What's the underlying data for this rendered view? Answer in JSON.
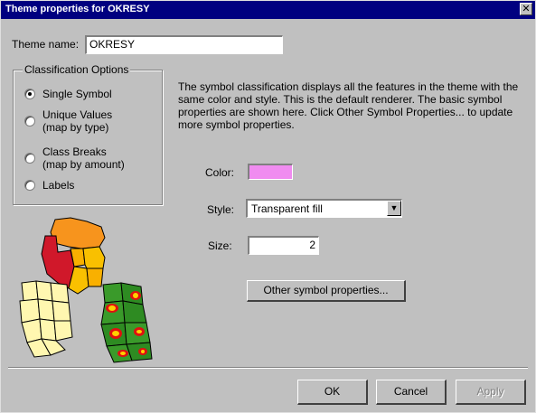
{
  "window": {
    "title": "Theme properties for OKRESY",
    "close_glyph": "✕"
  },
  "theme_name": {
    "label": "Theme name:",
    "value": "OKRESY"
  },
  "classification": {
    "legend": "Classification Options",
    "options": [
      {
        "line1": "Single Symbol",
        "line2": "",
        "checked": true
      },
      {
        "line1": "Unique Values",
        "line2": "(map by type)",
        "checked": false
      },
      {
        "line1": "Class Breaks",
        "line2": "(map by amount)",
        "checked": false
      },
      {
        "line1": "Labels",
        "line2": "",
        "checked": false
      }
    ]
  },
  "description": "The symbol classification displays all the features in the theme with the same color and style. This is the default renderer. The basic symbol properties are shown here. Click Other Symbol Properties... to update more symbol properties.",
  "symbol": {
    "color_label": "Color:",
    "color_value": "#f08cf0",
    "style_label": "Style:",
    "style_value": "Transparent fill",
    "size_label": "Size:",
    "size_value": "2",
    "other_button": "Other symbol properties..."
  },
  "buttons": {
    "ok": "OK",
    "cancel": "Cancel",
    "apply": "Apply"
  },
  "icons": {
    "illustration": "map-illustration-icon",
    "dropdown": "chevron-down-icon"
  }
}
